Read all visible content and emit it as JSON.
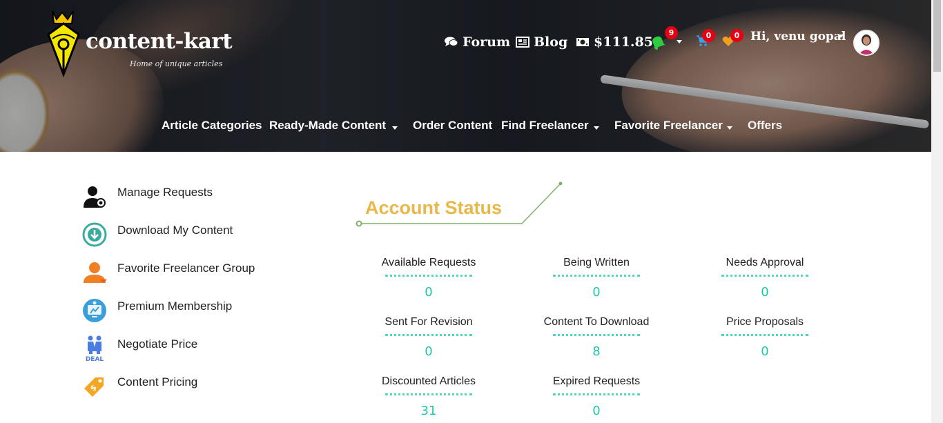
{
  "brand": {
    "name": "content-kart",
    "tagline": "Home of unique articles"
  },
  "top_nav": {
    "forum": "Forum",
    "blog": "Blog",
    "balance": "$111.85",
    "notifications_count": "9",
    "cart_count": "0",
    "favorites_count": "0",
    "greeting": "Hi, venu gopal"
  },
  "main_nav": {
    "items": [
      "Article Categories",
      "Ready-Made Content",
      "Order Content",
      "Find Freelancer",
      "Favorite Freelancer",
      "Offers"
    ]
  },
  "sidebar": {
    "items": [
      {
        "label": "Manage Requests",
        "icon": "manage-requests-icon"
      },
      {
        "label": "Download My Content",
        "icon": "download-icon"
      },
      {
        "label": "Favorite Freelancer Group",
        "icon": "user-group-icon"
      },
      {
        "label": "Premium Membership",
        "icon": "premium-icon"
      },
      {
        "label": "Negotiate Price",
        "icon": "deal-icon"
      },
      {
        "label": "Content Pricing",
        "icon": "price-tag-icon"
      }
    ],
    "deal_icon_text": "DEAL"
  },
  "account_status": {
    "title": "Account Status",
    "stats": [
      {
        "label": "Available Requests",
        "value": "0"
      },
      {
        "label": "Being Written",
        "value": "0"
      },
      {
        "label": "Needs Approval",
        "value": "0"
      },
      {
        "label": "Sent For Revision",
        "value": "0"
      },
      {
        "label": "Content To Download",
        "value": "8"
      },
      {
        "label": "Price Proposals",
        "value": "0"
      },
      {
        "label": "Discounted Articles",
        "value": "31"
      },
      {
        "label": "Expired Requests",
        "value": "0"
      }
    ]
  },
  "colors": {
    "accent_gold": "#e8b84a",
    "stat_teal": "#1ec7a9",
    "badge_red": "#e60012",
    "bell_green": "#2ecc40",
    "cart_blue": "#3aa0e8",
    "heart_orange": "#f0a020"
  }
}
